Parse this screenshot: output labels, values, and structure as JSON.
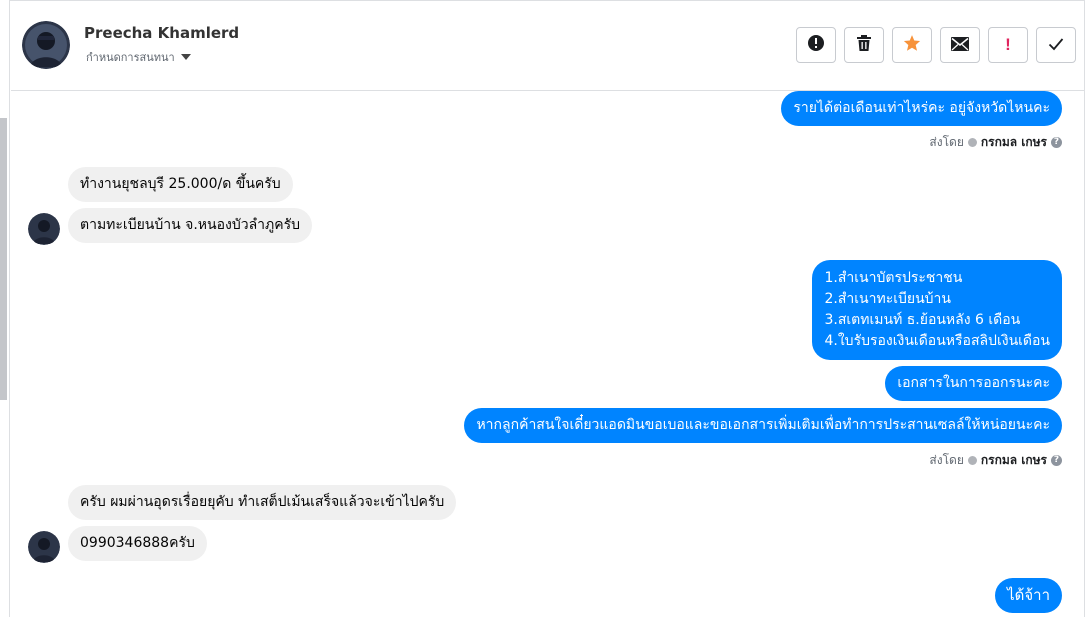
{
  "header": {
    "name": "Preecha Khamlerd",
    "subtitle": "กำหนดการสนทนา",
    "actions": [
      {
        "icon": "report-icon"
      },
      {
        "icon": "trash-icon"
      },
      {
        "icon": "star-icon"
      },
      {
        "icon": "mail-icon"
      },
      {
        "icon": "important-icon",
        "label": "!"
      },
      {
        "icon": "check-icon"
      }
    ]
  },
  "messages": {
    "m1": "รายได้ต่อเดือนเท่าไหร่คะ อยู่จังหวัดไหนคะ",
    "sent1": {
      "prefix": "ส่งโดย",
      "name": "กรกมล เกษร"
    },
    "m2": "ทำงานยุชลบุรี  25.000/ด  ขึ้นครับ",
    "m3": "ตามทะเบียนบ้าน  จ.หนองบัวลำภูครับ",
    "m4_lines": [
      "1.สำเนาบัตรประชาชน",
      "2.สำเนาทะเบียนบ้าน",
      "3.สเตทเมนท์ ธ.ย้อนหลัง 6 เดือน",
      "4.ใบรับรองเงินเดือนหรือสลิปเงินเดือน"
    ],
    "m5": "เอกสารในการออกรนะคะ",
    "m6": "หากลูกค้าสนใจเดี๋ยวแอดมินขอเบอและขอเอกสารเพิ่มเติมเพื่อทำการประสานเซลล์ให้หน่อยนะคะ",
    "sent2": {
      "prefix": "ส่งโดย",
      "name": "กรกมล เกษร"
    },
    "m7": "ครับ  ผมผ่านอุดรเรื่อยยุคับ  ทำเสต็ปเม้นเสร็จแล้วจะเข้าไปครับ",
    "m8": "0990346888ครับ",
    "m9": "ได้จ้าา"
  },
  "colors": {
    "outgoing": "#0084ff",
    "incoming": "#f0f0f0",
    "star": "#f7923a",
    "important": "#e0245e"
  }
}
